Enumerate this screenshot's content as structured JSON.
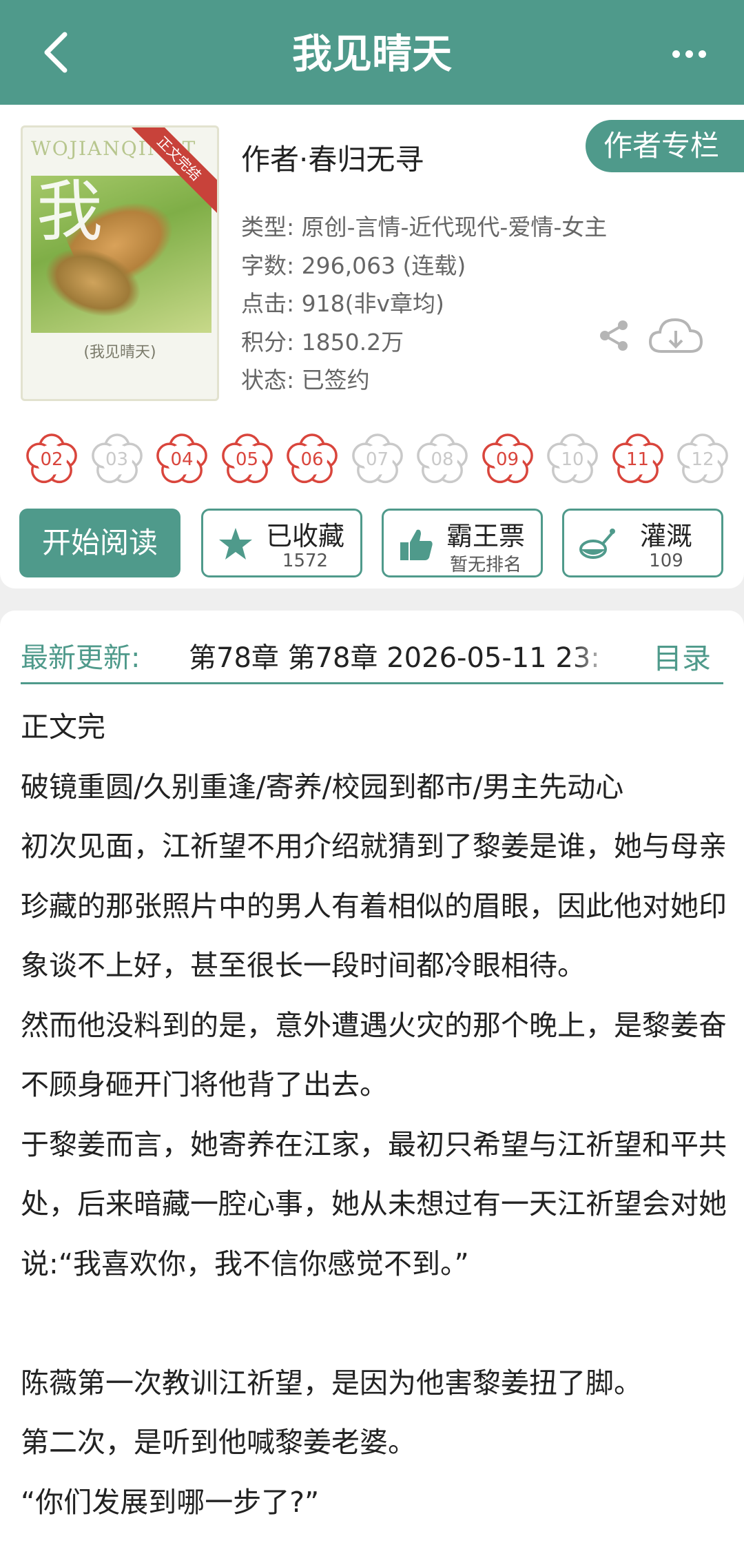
{
  "colors": {
    "accent": "#4f9a8b",
    "flower_red": "#d9453c",
    "flower_grey": "#c9c9c9"
  },
  "header": {
    "title": "我见晴天",
    "back_icon": "chevron-left-icon",
    "more_icon": "more-dots-icon"
  },
  "book": {
    "cover": {
      "top_text": "WOJIANQINGT",
      "ribbon": "正文完结",
      "subtitle": "(我见晴天)",
      "glyph": "我"
    },
    "author_line": "作者·春归无寻",
    "author_column_button": "作者专栏",
    "meta": [
      "类型: 原创-言情-近代现代-爱情-女主",
      "字数: 296,063 (连载)",
      "点击: 918(非v章均)",
      "积分: 1850.2万",
      "状态: 已签约"
    ]
  },
  "flowers": [
    {
      "label": "02",
      "active": true
    },
    {
      "label": "03",
      "active": false
    },
    {
      "label": "04",
      "active": true
    },
    {
      "label": "05",
      "active": true
    },
    {
      "label": "06",
      "active": true
    },
    {
      "label": "07",
      "active": false
    },
    {
      "label": "08",
      "active": false
    },
    {
      "label": "09",
      "active": true
    },
    {
      "label": "10",
      "active": false
    },
    {
      "label": "11",
      "active": true
    },
    {
      "label": "12",
      "active": false
    }
  ],
  "actions": {
    "start_reading": "开始阅读",
    "collect": {
      "label": "已收藏",
      "count": "1572",
      "icon": "star-icon"
    },
    "vote": {
      "label": "霸王票",
      "sub": "暂无排名",
      "icon": "thumbs-up-icon"
    },
    "water": {
      "label": "灌溉",
      "count": "109",
      "icon": "watering-can-icon"
    }
  },
  "latest": {
    "label": "最新更新:",
    "chapter": "第78章  第78章  2026-05-11 23:",
    "toc": "目录"
  },
  "synopsis": [
    "正文完",
    "破镜重圆/久别重逢/寄养/校园到都市/男主先动心",
    "初次见面，江祈望不用介绍就猜到了黎姜是谁，她与母亲珍藏的那张照片中的男人有着相似的眉眼，因此他对她印象谈不上好，甚至很长一段时间都冷眼相待。",
    "然而他没料到的是，意外遭遇火灾的那个晚上，是黎姜奋不顾身砸开门将他背了出去。",
    "于黎姜而言，她寄养在江家，最初只希望与江祈望和平共处，后来暗藏一腔心事，她从未想过有一天江祈望会对她说:“我喜欢你，我不信你感觉不到。”",
    "",
    "陈薇第一次教训江祈望，是因为他害黎姜扭了脚。",
    "第二次，是听到他喊黎姜老婆。",
    "“你们发展到哪一步了?”"
  ]
}
